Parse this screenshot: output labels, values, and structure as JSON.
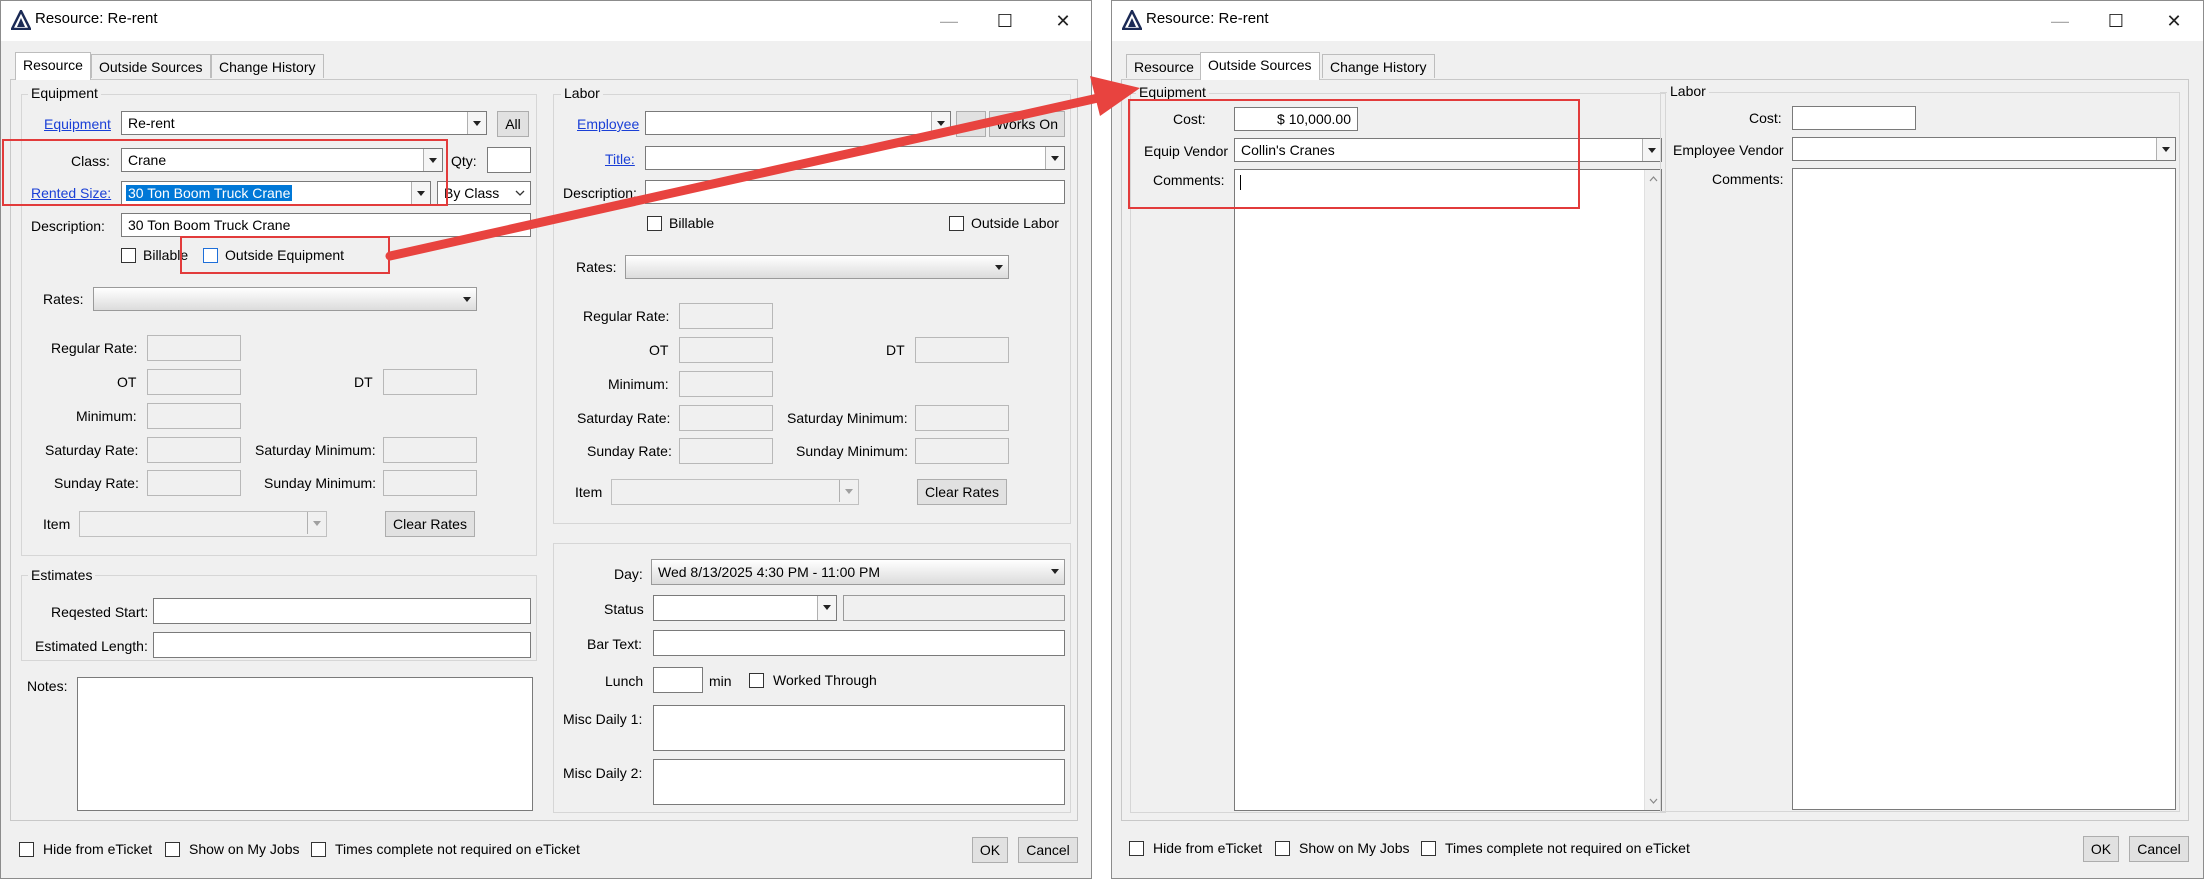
{
  "window_left": {
    "title": "Resource: Re-rent",
    "tabs": [
      "Resource",
      "Outside Sources",
      "Change History"
    ],
    "equipment": {
      "group_label": "Equipment",
      "equipment_link": "Equipment",
      "equipment_value": "Re-rent",
      "all_button": "All",
      "class_label": "Class:",
      "class_value": "Crane",
      "qty_label": "Qty:",
      "rented_size_link": "Rented Size:",
      "rented_size_value": "30 Ton Boom Truck Crane",
      "by_class_value": "By Class",
      "description_label": "Description:",
      "description_value": "30 Ton Boom Truck Crane",
      "billable_label": "Billable",
      "outside_equipment_label": "Outside Equipment",
      "rates_label": "Rates:",
      "regular_rate_label": "Regular Rate:",
      "ot_label": "OT",
      "dt_label": "DT",
      "minimum_label": "Minimum:",
      "saturday_rate_label": "Saturday Rate:",
      "saturday_minimum_label": "Saturday Minimum:",
      "sunday_rate_label": "Sunday Rate:",
      "sunday_minimum_label": "Sunday Minimum:",
      "item_label": "Item",
      "clear_rates_button": "Clear Rates"
    },
    "labor": {
      "group_label": "Labor",
      "employee_link": "Employee",
      "ellipsis_button": "...",
      "works_on_button": "Works On",
      "title_link": "Title:",
      "description_label": "Description:",
      "billable_label": "Billable",
      "outside_labor_label": "Outside Labor",
      "rates_label": "Rates:",
      "regular_rate_label": "Regular Rate:",
      "ot_label": "OT",
      "dt_label": "DT",
      "minimum_label": "Minimum:",
      "saturday_rate_label": "Saturday Rate:",
      "saturday_minimum_label": "Saturday Minimum:",
      "sunday_rate_label": "Sunday Rate:",
      "sunday_minimum_label": "Sunday Minimum:",
      "item_label": "Item",
      "clear_rates_button": "Clear Rates"
    },
    "estimates": {
      "group_label": "Estimates",
      "requested_start_label": "Reqested Start:",
      "estimated_length_label": "Estimated Length:"
    },
    "notes_label": "Notes:",
    "schedule": {
      "day_label": "Day:",
      "day_value": "Wed 8/13/2025 4:30 PM - 11:00 PM",
      "status_label": "Status",
      "bar_text_label": "Bar Text:",
      "lunch_label": "Lunch",
      "min_label": "min",
      "worked_through_label": "Worked Through",
      "misc_daily_1_label": "Misc Daily 1:",
      "misc_daily_2_label": "Misc Daily 2:"
    },
    "footer": {
      "hide_from_eticket": "Hide from eTicket",
      "show_on_my_jobs": "Show on My Jobs",
      "times_complete": "Times complete not required on eTicket",
      "ok_button": "OK",
      "cancel_button": "Cancel"
    }
  },
  "window_right": {
    "title": "Resource: Re-rent",
    "tabs": [
      "Resource",
      "Outside Sources",
      "Change History"
    ],
    "equipment": {
      "group_label": "Equipment",
      "cost_label": "Cost:",
      "cost_value": "$ 10,000.00",
      "equip_vendor_label": "Equip Vendor",
      "equip_vendor_value": "Collin's Cranes",
      "comments_label": "Comments:"
    },
    "labor": {
      "group_label": "Labor",
      "cost_label": "Cost:",
      "employee_vendor_label": "Employee Vendor",
      "comments_label": "Comments:"
    },
    "footer": {
      "hide_from_eticket": "Hide from eTicket",
      "show_on_my_jobs": "Show on My Jobs",
      "times_complete": "Times complete not required on eTicket",
      "ok_button": "OK",
      "cancel_button": "Cancel"
    }
  },
  "colors": {
    "annotation_red": "#e23b3b",
    "link_blue": "#1a3fd6",
    "selection_blue": "#0078d7"
  }
}
